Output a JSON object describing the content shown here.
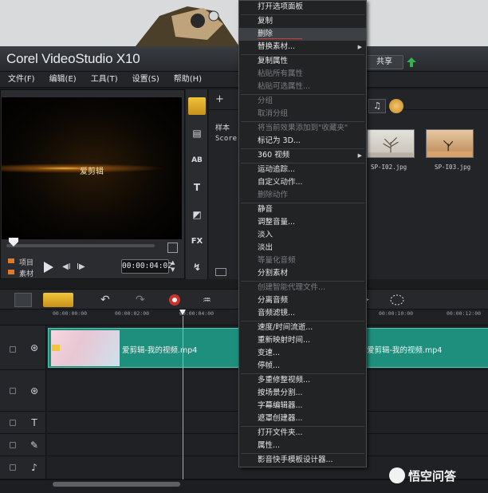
{
  "app": {
    "brand": "Corel VideoStudio X10",
    "share_tab": "共享"
  },
  "menubar": [
    "文件(F)",
    "编辑(E)",
    "工具(T)",
    "设置(S)",
    "帮助(H)"
  ],
  "preview": {
    "watermark": "爱剪辑",
    "mode_project": "项目",
    "mode_clip": "素材",
    "prev": "◀I",
    "next": "I▶",
    "timecode": "00:00:04:02"
  },
  "library": {
    "add": "+",
    "sample": "样本",
    "score": "Score",
    "thumbs": [
      {
        "label": "SP-I02.jpg"
      },
      {
        "label": "SP-I03.jpg"
      }
    ],
    "music_filter": "♫"
  },
  "side_tabs": {
    "text": "T",
    "fx": "FX",
    "title": "AB"
  },
  "ruler": [
    "00:00:00:00",
    "00:00:02:00",
    "00:00:04:00",
    "00:00:10:00",
    "00:00:12:00"
  ],
  "timeline": {
    "clip1_label": "爱剪辑-我的视频.mp4",
    "clip2_label": "爱剪辑-我的视频.mp4"
  },
  "context_menu": [
    {
      "label": "打开选项面板",
      "disabled": false
    },
    {
      "sep": true
    },
    {
      "label": "复制",
      "disabled": false
    },
    {
      "label": "删除",
      "disabled": false,
      "highlight": true
    },
    {
      "label": "替换素材...",
      "disabled": false,
      "submenu": true
    },
    {
      "sep": true
    },
    {
      "label": "复制属性",
      "disabled": false
    },
    {
      "label": "粘贴所有属性",
      "disabled": true
    },
    {
      "label": "粘贴可选属性...",
      "disabled": true
    },
    {
      "sep": true
    },
    {
      "label": "分组",
      "disabled": true
    },
    {
      "label": "取消分组",
      "disabled": true
    },
    {
      "sep": true
    },
    {
      "label": "将当前效果添加到\"收藏夹\"",
      "disabled": true
    },
    {
      "label": "标记为 3D...",
      "disabled": false
    },
    {
      "sep": true
    },
    {
      "label": "360 视频",
      "disabled": false,
      "submenu": true
    },
    {
      "sep": true
    },
    {
      "label": "运动追踪...",
      "disabled": false
    },
    {
      "label": "自定义动作...",
      "disabled": false
    },
    {
      "label": "删除动作",
      "disabled": true
    },
    {
      "sep": true
    },
    {
      "label": "静音",
      "disabled": false
    },
    {
      "label": "调整音量...",
      "disabled": false
    },
    {
      "label": "淡入",
      "disabled": false
    },
    {
      "label": "淡出",
      "disabled": false
    },
    {
      "label": "等量化音频",
      "disabled": true
    },
    {
      "label": "分割素材",
      "disabled": false
    },
    {
      "sep": true
    },
    {
      "label": "创建智能代理文件...",
      "disabled": true
    },
    {
      "label": "分离音频",
      "disabled": false
    },
    {
      "label": "音频滤镜...",
      "disabled": false
    },
    {
      "sep": true
    },
    {
      "label": "速度/时间流逝...",
      "disabled": false
    },
    {
      "label": "重新映射时间...",
      "disabled": false
    },
    {
      "label": "变速...",
      "disabled": false
    },
    {
      "label": "停帧...",
      "disabled": false
    },
    {
      "sep": true
    },
    {
      "label": "多重修整视频...",
      "disabled": false
    },
    {
      "label": "按场景分割...",
      "disabled": false
    },
    {
      "label": "字幕编辑器...",
      "disabled": false
    },
    {
      "label": "遮罩创建器...",
      "disabled": false
    },
    {
      "sep": true
    },
    {
      "label": "打开文件夹...",
      "disabled": false
    },
    {
      "label": "属性...",
      "disabled": false
    },
    {
      "sep": true
    },
    {
      "label": "影音快手模板设计器...",
      "disabled": false
    }
  ],
  "watermark": {
    "text": "悟空问答"
  },
  "colors": {
    "accent": "#f2c63a",
    "clip": "#1f8f7d",
    "menu_bg": "#222325"
  }
}
